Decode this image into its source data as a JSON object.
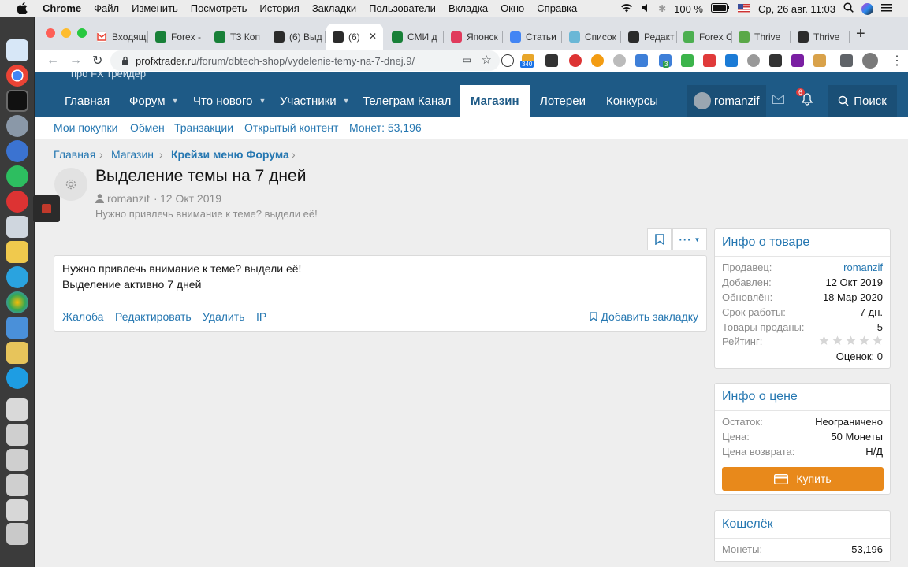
{
  "menubar": {
    "app": "Chrome",
    "items": [
      "Файл",
      "Изменить",
      "Посмотреть",
      "История",
      "Закладки",
      "Пользователи",
      "Вкладка",
      "Окно",
      "Справка"
    ],
    "battery": "100 %",
    "clock": "Ср, 26 авг.  11:03"
  },
  "tabs": [
    {
      "label": "Входящ",
      "icon": "gmail-icon",
      "color": "#ffffff"
    },
    {
      "label": "Forex -",
      "icon": "sheets-icon",
      "color": "#188038"
    },
    {
      "label": "ТЗ Коп",
      "icon": "sheets-icon",
      "color": "#188038"
    },
    {
      "label": "(6) Выд",
      "icon": "site-icon",
      "color": "#2b2b2b"
    },
    {
      "label": "(6) ",
      "icon": "site-icon",
      "color": "#2b2b2b",
      "active": true,
      "close": "✕"
    },
    {
      "label": "СМИ д",
      "icon": "sheets-icon",
      "color": "#188038"
    },
    {
      "label": "Японск",
      "icon": "target-icon",
      "color": "#e03a5c"
    },
    {
      "label": "Статьи",
      "icon": "docs-icon",
      "color": "#4285f4"
    },
    {
      "label": "Список",
      "icon": "circle-icon",
      "color": "#6ab7d6"
    },
    {
      "label": "Редакт",
      "icon": "site-icon",
      "color": "#2b2b2b"
    },
    {
      "label": "Forex C",
      "icon": "four-icon",
      "color": "#4caf50"
    },
    {
      "label": "Thrive",
      "icon": "leaf-icon",
      "color": "#5aa848"
    },
    {
      "label": "Thrive",
      "icon": "site-icon",
      "color": "#2b2b2b"
    }
  ],
  "new_tab": "+",
  "address": {
    "domain": "profxtrader.ru",
    "path": "/forum/dbtech-shop/vydelenie-temy-na-7-dnej.9/"
  },
  "extensions": {
    "badge_1": "340",
    "badge_2": "3"
  },
  "site": {
    "tagline": "про FX трейдер",
    "nav": [
      {
        "label": "Главная",
        "caret": false
      },
      {
        "label": "Форум",
        "caret": true
      },
      {
        "label": "Что нового",
        "caret": true
      },
      {
        "label": "Участники",
        "caret": true
      },
      {
        "label": "Телеграм Канал",
        "caret": false
      },
      {
        "label": "Магазин",
        "caret": false,
        "active": true
      },
      {
        "label": "Лотереи",
        "caret": false
      },
      {
        "label": "Конкурсы",
        "caret": false
      }
    ],
    "user": "romanzif",
    "alerts_badge": "6",
    "search": "Поиск",
    "subnav": [
      "Мои покупки",
      "Обмен",
      "Транзакции",
      "Открытый контент",
      "Монет: 53,196"
    ]
  },
  "breadcrumbs": [
    "Главная",
    "Магазин",
    "Крейзи меню Форума"
  ],
  "page": {
    "title": "Выделение темы на 7 дней",
    "author": "romanzif",
    "date": "12 Окт 2019",
    "description": "Нужно привлечь внимание к теме? выдели её!"
  },
  "post": {
    "line1": "Нужно привлечь внимание к теме? выдели её!",
    "line2": "Выделение активно 7 дней",
    "actions": [
      "Жалоба",
      "Редактировать",
      "Удалить",
      "IP"
    ],
    "bookmark": "Добавить закладку"
  },
  "item_info": {
    "title": "Инфо о товаре",
    "rows": [
      {
        "k": "Продавец:",
        "v": "romanzif"
      },
      {
        "k": "Добавлен:",
        "v": "12 Окт 2019"
      },
      {
        "k": "Обновлён:",
        "v": "18 Мар 2020"
      },
      {
        "k": "Срок работы:",
        "v": "7 дн."
      },
      {
        "k": "Товары проданы:",
        "v": "5"
      }
    ],
    "rating_label": "Рейтинг:",
    "rating_value": 0,
    "rating_max": 5,
    "votes": "Оценок: 0"
  },
  "price_info": {
    "title": "Инфо о цене",
    "rows": [
      {
        "k": "Остаток:",
        "v": "Неограничено"
      },
      {
        "k": "Цена:",
        "v": "50 Монеты"
      },
      {
        "k": "Цена возврата:",
        "v": "Н/Д"
      }
    ],
    "buy": "Купить"
  },
  "wallet": {
    "title": "Кошелёк",
    "label": "Монеты:",
    "value": "53,196"
  },
  "colors": {
    "brand": "#1e5a86",
    "link": "#2577b1",
    "buy": "#e8891b"
  }
}
